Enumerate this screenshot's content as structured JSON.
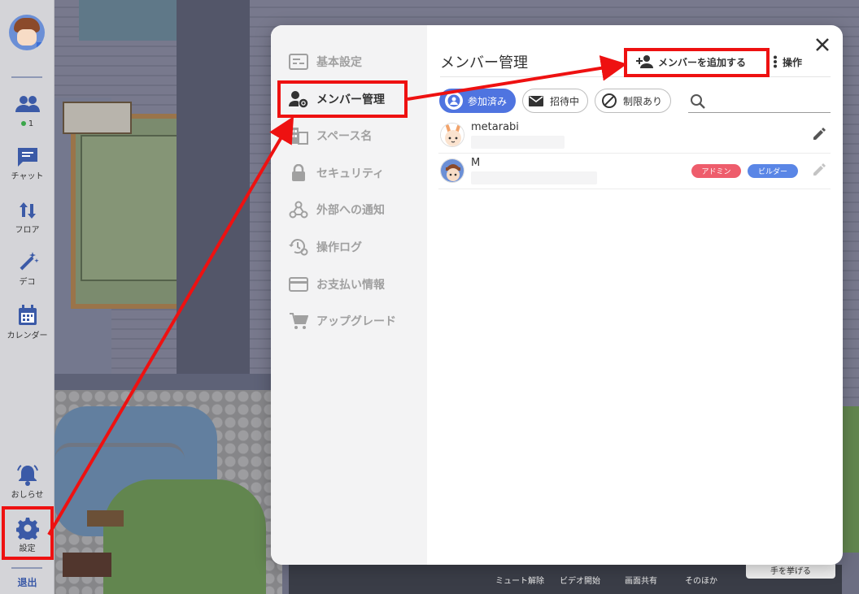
{
  "sidebar": {
    "online_count": "1",
    "items": [
      {
        "label": "チャット",
        "icon": "chat-icon"
      },
      {
        "label": "フロア",
        "icon": "floor-swap-icon"
      },
      {
        "label": "デコ",
        "icon": "magic-wand-icon"
      },
      {
        "label": "カレンダー",
        "icon": "calendar-icon"
      },
      {
        "label": "おしらせ",
        "icon": "bell-icon"
      },
      {
        "label": "設定",
        "icon": "gear-icon"
      }
    ],
    "exit_label": "退出"
  },
  "settings_nav": {
    "items": [
      {
        "label": "基本設定",
        "icon": "settings-panel-icon"
      },
      {
        "label": "メンバー管理",
        "icon": "member-manage-icon"
      },
      {
        "label": "スペース名",
        "icon": "building-icon"
      },
      {
        "label": "セキュリティ",
        "icon": "lock-icon"
      },
      {
        "label": "外部への通知",
        "icon": "webhook-icon"
      },
      {
        "label": "操作ログ",
        "icon": "history-gear-icon"
      },
      {
        "label": "お支払い情報",
        "icon": "credit-card-icon"
      },
      {
        "label": "アップグレード",
        "icon": "cart-icon"
      }
    ],
    "active_index": 1
  },
  "member_panel": {
    "title": "メンバー管理",
    "add_member_label": "メンバーを追加する",
    "operations_label": "操作",
    "filters": [
      {
        "label": "参加済み",
        "icon": "user-circle-icon",
        "active": true
      },
      {
        "label": "招待中",
        "icon": "envelope-icon",
        "active": false
      },
      {
        "label": "制限あり",
        "icon": "block-icon",
        "active": false
      }
    ],
    "search_placeholder": "",
    "members": [
      {
        "name": "metarabi",
        "badges": []
      },
      {
        "name": "M",
        "badges": [
          "アドミン",
          "ビルダー"
        ]
      }
    ]
  },
  "bottom_bar": {
    "labels": [
      "ミュート解除",
      "ビデオ開始",
      "画面共有",
      "そのほか"
    ],
    "raise_hand_label": "手を挙げる"
  },
  "colors": {
    "accent": "#4f74e0",
    "annotation": "#ee1111",
    "admin_badge": "#ee5d6c",
    "builder_badge": "#5a86e6"
  }
}
